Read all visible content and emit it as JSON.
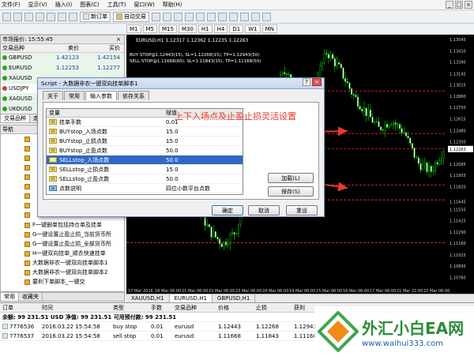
{
  "menu": [
    "文件(F)",
    "显示(V)",
    "插入(I)",
    "图表(C)",
    "工具(T)",
    "窗口(W)",
    "帮助(H)"
  ],
  "toolbar": {
    "new_order": "新订单",
    "autotrade": "自动交易"
  },
  "timeframes": [
    "M1",
    "M5",
    "M15",
    "M30",
    "H1",
    "H4",
    "D1",
    "W1",
    "MN"
  ],
  "market_watch": {
    "title": "市场报价: 15:55:45",
    "columns": [
      "交易品种",
      "卖价",
      "买价"
    ],
    "rows": [
      {
        "symbol": "GBPUSD",
        "bid": "1.42123",
        "ask": "1.42154"
      },
      {
        "symbol": "EURUSD",
        "bid": "1.12253",
        "ask": "1.12277"
      },
      {
        "symbol": "XAUUSD",
        "bid": "",
        "ask": ""
      },
      {
        "symbol": "USDJPY",
        "bid": "",
        "ask": ""
      },
      {
        "symbol": "XAGUSD",
        "bid": "",
        "ask": ""
      },
      {
        "symbol": "UKOUSD",
        "bid": "",
        "ask": ""
      }
    ],
    "tabs": [
      "交易品种",
      "走"
    ]
  },
  "navigator": {
    "title": "导航",
    "items": [
      "F一键删单包括持仓单及挂单",
      "G一键设置止盈止损_当前货币所",
      "G一键设置止盈止损_全部货币所",
      "H一键双向挂单_顺衣快速挂单",
      "大数据非农一键双向挂单脚本1",
      "大数据非农一键双向挂单脚本2",
      "要利下单脚本_一键交"
    ],
    "tabs": [
      "常用",
      "收藏夹"
    ]
  },
  "chart": {
    "title": "EURUSD,H1  1.12317 1.12362 1.12235 1.12263",
    "line1": "BUY STOP@1.12443(15), SL=1.12268(15), TP=1.12943(50)",
    "line2": "SELL STOP@1.11668(60), SL=1.11843(15), TP=1.11168(50)",
    "prices": [
      "1.13545",
      "1.13410",
      "1.13280",
      "1.13145",
      "1.13015",
      "1.12880",
      "1.12750",
      "1.12615",
      "1.12480",
      "1.12350",
      "1.12263",
      "1.12085",
      "1.11955",
      "1.11820",
      "1.11645",
      "1.11555",
      "1.11425",
      "1.11290",
      "1.11160",
      "1.11025",
      "1.10895",
      "1.10760"
    ],
    "dates": [
      "17 Mar 2016",
      "18 Mar 06:00",
      "21 Mar 06:00",
      "22 Mar 06:00",
      "23 Mar 06:00",
      "24 Mar 06:00",
      "14 Mar 06:00",
      "15 Mar 06:00",
      "16 Mar 06:00",
      "17 Mar 06:00",
      "21 Mar 22:00",
      "22 Mar 06:00"
    ],
    "tabs": [
      "XAUUSD,H1",
      "EURUSD,H1",
      "GBPUSD,H1"
    ],
    "current_price": "1.12263",
    "colors": {
      "up": "#00e000",
      "down": "#ffffff",
      "level": "#ff3030",
      "price": "#c0c0c0"
    }
  },
  "annotation": "上下入场点及止盈止损灵活设置",
  "dialog": {
    "title": "Script - 大数据非农一键双向挂单脚本1",
    "tabs": [
      "关于",
      "常用",
      "输入参数",
      "依存关系"
    ],
    "columns": [
      "变量",
      "赋值"
    ],
    "params": [
      {
        "name": "挂单手数",
        "value": "0.01"
      },
      {
        "name": "BUYstop_入场点数",
        "value": "15.0"
      },
      {
        "name": "BUYstop_止损点数",
        "value": "15.0"
      },
      {
        "name": "BUYstop_止盈点数",
        "value": "50.0"
      },
      {
        "name": "SELLstop_入场点数",
        "value": "50.0"
      },
      {
        "name": "SELLstop_止损点数",
        "value": "15.0"
      },
      {
        "name": "SELLstop_止盈点数",
        "value": "50.0"
      },
      {
        "name": "点数说明",
        "value": "四位小数平台点数"
      }
    ],
    "load": "加载(L)",
    "save": "保存(S)",
    "ok": "确定",
    "cancel": "取消",
    "reset": "重设"
  },
  "terminal": {
    "columns": [
      "订单",
      "时间",
      "类型",
      "手数",
      "交易品种",
      "价格",
      "止损",
      "获利"
    ],
    "balance": "余额: 99 231.51 USD  净值: 99 231.51  可用预付款: 99 231.51",
    "rows": [
      {
        "order": "7776536",
        "time": "2016.03.22 15:54:58",
        "type": "buy stop",
        "lots": "0.01",
        "symbol": "eurusd",
        "price": "1.12443",
        "sl": "1.12268",
        "tp": "1.12943"
      },
      {
        "order": "7776537",
        "time": "2016.03.22 15:54:58",
        "type": "sell stop",
        "lots": "0.01",
        "symbol": "eurusd",
        "price": "1.11668",
        "sl": "1.11843",
        "tp": "1.11168"
      }
    ]
  },
  "watermark": {
    "brand": "外汇小白EA网",
    "url": "www.waihui333.com"
  }
}
